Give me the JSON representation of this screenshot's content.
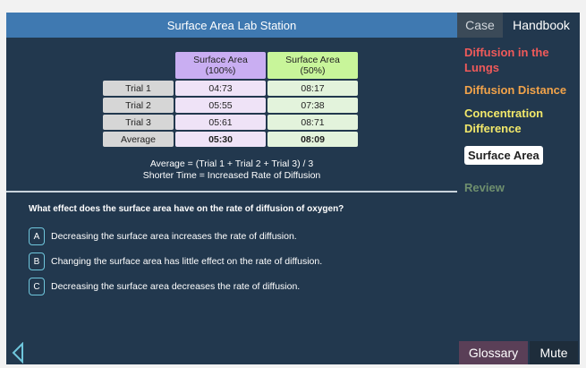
{
  "main": {
    "title": "Surface Area Lab Station",
    "table": {
      "col_a": [
        "Surface Area",
        "(100%)"
      ],
      "col_b": [
        "Surface Area",
        "(50%)"
      ],
      "rows": [
        {
          "label": "Trial 1",
          "a": "04:73",
          "b": "08:17"
        },
        {
          "label": "Trial 2",
          "a": "05:55",
          "b": "07:38"
        },
        {
          "label": "Trial 3",
          "a": "05:61",
          "b": "08:71"
        },
        {
          "label": "Average",
          "a": "05:30",
          "b": "08:09"
        }
      ]
    },
    "formula_1": "Average = (Trial 1 + Trial 2 + Trial 3) / 3",
    "formula_2": "Shorter Time = Increased Rate of Diffusion",
    "question": "What effect does the surface area have on the rate of diffusion of oxygen?",
    "options": [
      {
        "letter": "A",
        "text": "Decreasing the surface area increases the rate of diffusion."
      },
      {
        "letter": "B",
        "text": "Changing the surface area has little effect on the rate of diffusion."
      },
      {
        "letter": "C",
        "text": "Decreasing the surface area decreases the rate of diffusion."
      }
    ]
  },
  "sidebar": {
    "tabs": [
      "Case",
      "Handbook"
    ],
    "items": [
      {
        "label": "Diffusion in the Lungs",
        "color": "#f05a5a"
      },
      {
        "label": "Diffusion Distance",
        "color": "#f2a34a"
      },
      {
        "label": "Concentration Difference",
        "color": "#f2e86a"
      },
      {
        "label": "Surface Area",
        "color": "#ffffff"
      },
      {
        "label": "Review",
        "color": "#6f8f6e"
      }
    ],
    "glossary": "Glossary",
    "mute": "Mute"
  },
  "icons": {
    "back": "back-arrow-icon"
  },
  "colors": {
    "accent": "#3f79b1",
    "background": "#22384e",
    "option_border": "#6fc6dc"
  }
}
